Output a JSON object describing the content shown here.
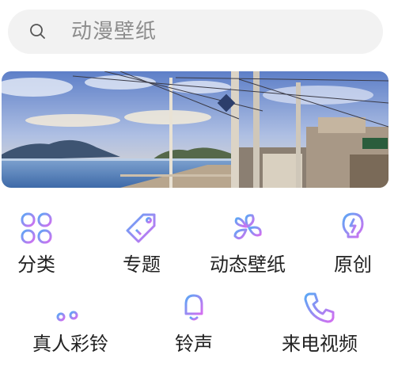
{
  "search": {
    "placeholder": "动漫壁纸",
    "icon": "search-icon"
  },
  "banner": {
    "description_icon": "banner-image"
  },
  "categories_row1": [
    {
      "label": "分类",
      "icon": "category-grid-icon"
    },
    {
      "label": "专题",
      "icon": "tag-icon"
    },
    {
      "label": "动态壁纸",
      "icon": "pinwheel-icon"
    },
    {
      "label": "原创",
      "icon": "lightbulb-icon"
    }
  ],
  "categories_row2": [
    {
      "label": "真人彩铃",
      "icon": "music-note-icon"
    },
    {
      "label": "铃声",
      "icon": "bell-icon"
    },
    {
      "label": "来电视频",
      "icon": "phone-icon"
    }
  ],
  "colors": {
    "accent_start": "#5aa8f5",
    "accent_end": "#d46ef0",
    "search_bg": "#f2f2f2",
    "placeholder": "#8d8d8d"
  }
}
